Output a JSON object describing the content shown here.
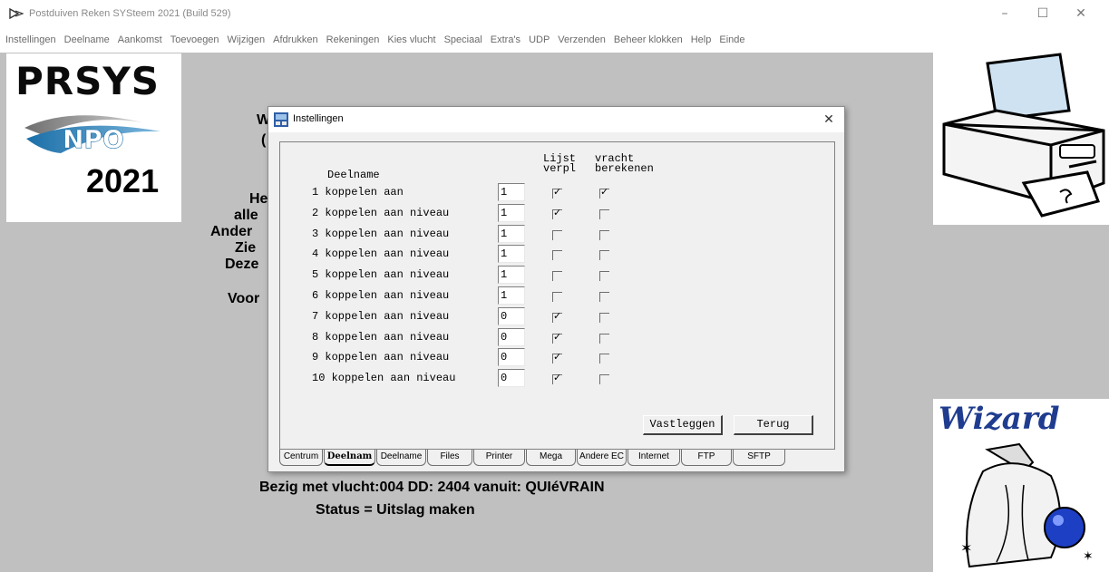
{
  "window": {
    "title": "Postduiven Reken SYSteem 2021 (Build 529)",
    "minimize_label": "–",
    "maximize_label": "☐",
    "close_label": "✕"
  },
  "menu": {
    "items": [
      "Instellingen",
      "Deelname",
      "Aankomst",
      "Toevoegen",
      "Wijzigen",
      "Afdrukken",
      "Rekeningen",
      "Kies vlucht",
      "Speciaal",
      "Extra's",
      "UDP",
      "Verzenden",
      "Beheer klokken",
      "Help",
      "Einde"
    ]
  },
  "logo": {
    "brand": "PRSYS",
    "sub": "NPO",
    "year": "2021"
  },
  "wizard": {
    "text": "Wizard"
  },
  "background": {
    "lines": [
      "W",
      "(",
      "He",
      "alle",
      "Ander",
      "Zie",
      "Deze",
      "Voor"
    ]
  },
  "dialog": {
    "title": "Instellingen",
    "close_label": "✕",
    "header_deelname": "Deelname",
    "header_lijst_1": "Lijst",
    "header_lijst_2": "verpl",
    "header_vracht_1": "vracht",
    "header_vracht_2": "berekenen",
    "rows": [
      {
        "label": "1 koppelen aan",
        "value": "1",
        "lijst": true,
        "vracht": true
      },
      {
        "label": "2 koppelen aan niveau",
        "value": "1",
        "lijst": true,
        "vracht": false
      },
      {
        "label": "3 koppelen aan niveau",
        "value": "1",
        "lijst": false,
        "vracht": false
      },
      {
        "label": "4 koppelen aan niveau",
        "value": "1",
        "lijst": false,
        "vracht": false
      },
      {
        "label": "5 koppelen aan niveau",
        "value": "1",
        "lijst": false,
        "vracht": false
      },
      {
        "label": "6 koppelen aan niveau",
        "value": "1",
        "lijst": false,
        "vracht": false
      },
      {
        "label": "7 koppelen aan niveau",
        "value": "0",
        "lijst": true,
        "vracht": false
      },
      {
        "label": "8 koppelen aan niveau",
        "value": "0",
        "lijst": true,
        "vracht": false
      },
      {
        "label": "9 koppelen aan niveau",
        "value": "0",
        "lijst": true,
        "vracht": false
      },
      {
        "label": "10 koppelen aan niveau",
        "value": "0",
        "lijst": true,
        "vracht": false
      }
    ],
    "buttons": {
      "save": "Vastleggen",
      "back": "Terug"
    },
    "tabs": [
      "Centrum",
      "Deelnam",
      "Deelname",
      "Files",
      "Printer",
      "Mega",
      "Andere EC",
      "Internet",
      "FTP",
      "SFTP"
    ],
    "active_tab": "Deelnam"
  },
  "status": {
    "flight": "Bezig met vlucht:004 DD: 2404 vanuit: QUIéVRAIN",
    "state": "Status = Uitslag maken"
  }
}
